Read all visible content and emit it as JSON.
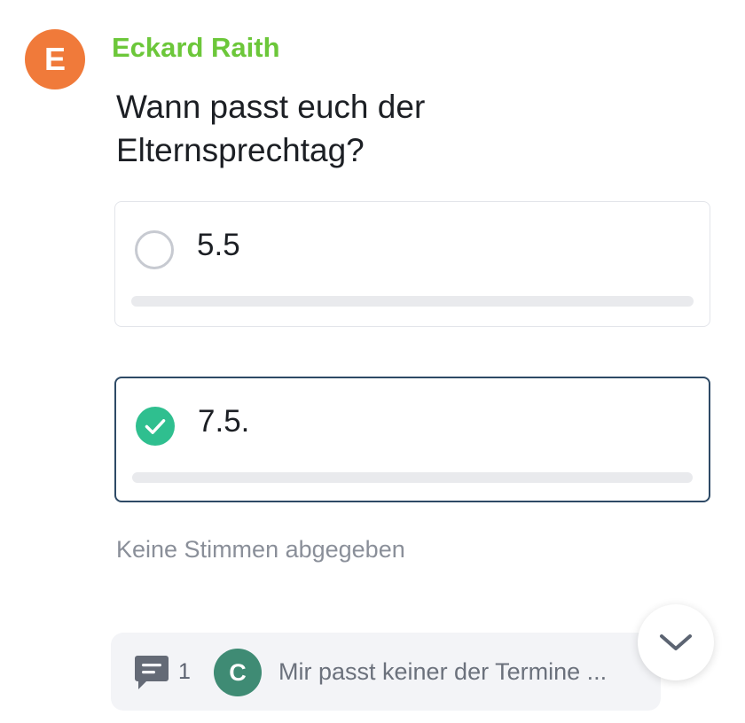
{
  "colors": {
    "avatar_bg": "#f07a3a",
    "author": "#6cc73a",
    "check": "#2fbf8f",
    "comment_avatar_bg": "#3f8b74",
    "comment_icon": "#646a76",
    "chevron": "#5c6472"
  },
  "post": {
    "avatar_letter": "E",
    "author": "Eckard Raith",
    "question": "Wann passt euch der Elternsprechtag?"
  },
  "poll": {
    "options": [
      {
        "label": "5.5",
        "selected": false,
        "vote_fraction": 0
      },
      {
        "label": "7.5.",
        "selected": true,
        "vote_fraction": 0
      }
    ],
    "votes_text": "Keine Stimmen abgegeben"
  },
  "comments": {
    "icon": "comment-icon",
    "count": "1",
    "commenter_letter": "C",
    "preview": "Mir passt keiner der Termine ..."
  },
  "scroll_button": {
    "icon": "chevron-down-icon"
  }
}
